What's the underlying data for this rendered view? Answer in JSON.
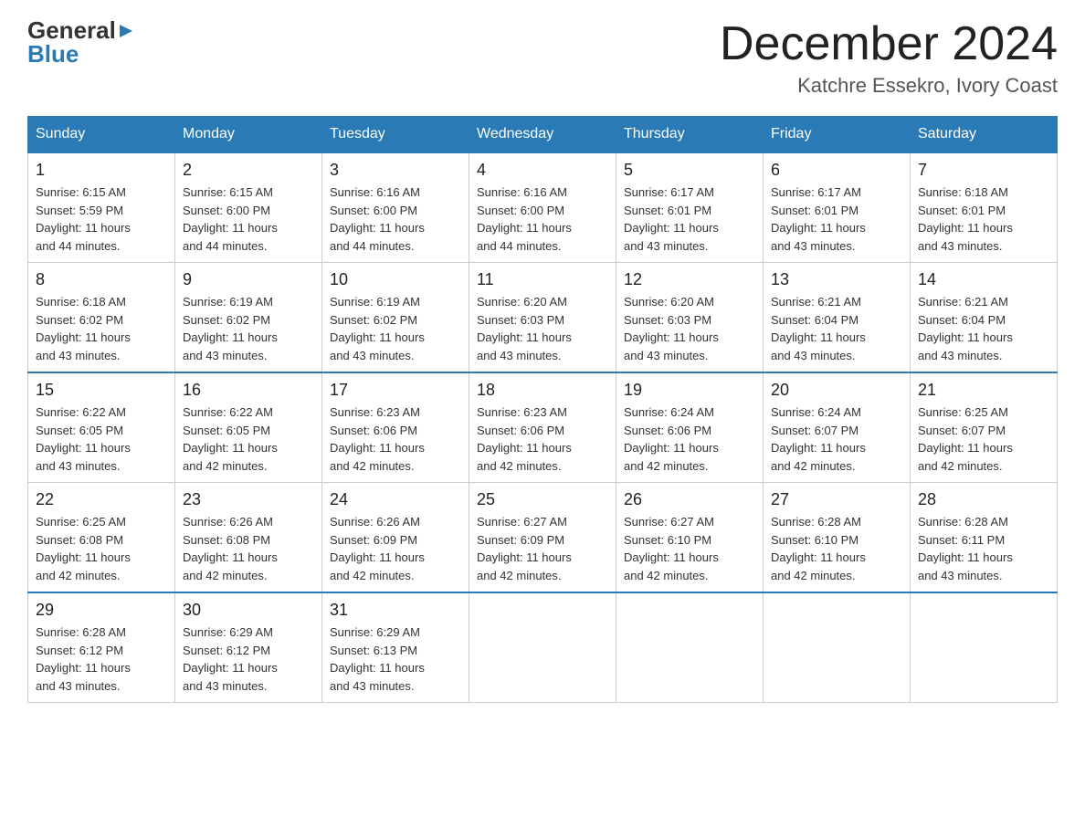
{
  "logo": {
    "general": "General",
    "blue": "Blue"
  },
  "title": "December 2024",
  "subtitle": "Katchre Essekro, Ivory Coast",
  "headers": [
    "Sunday",
    "Monday",
    "Tuesday",
    "Wednesday",
    "Thursday",
    "Friday",
    "Saturday"
  ],
  "weeks": [
    [
      {
        "day": "1",
        "info": "Sunrise: 6:15 AM\nSunset: 5:59 PM\nDaylight: 11 hours\nand 44 minutes."
      },
      {
        "day": "2",
        "info": "Sunrise: 6:15 AM\nSunset: 6:00 PM\nDaylight: 11 hours\nand 44 minutes."
      },
      {
        "day": "3",
        "info": "Sunrise: 6:16 AM\nSunset: 6:00 PM\nDaylight: 11 hours\nand 44 minutes."
      },
      {
        "day": "4",
        "info": "Sunrise: 6:16 AM\nSunset: 6:00 PM\nDaylight: 11 hours\nand 44 minutes."
      },
      {
        "day": "5",
        "info": "Sunrise: 6:17 AM\nSunset: 6:01 PM\nDaylight: 11 hours\nand 43 minutes."
      },
      {
        "day": "6",
        "info": "Sunrise: 6:17 AM\nSunset: 6:01 PM\nDaylight: 11 hours\nand 43 minutes."
      },
      {
        "day": "7",
        "info": "Sunrise: 6:18 AM\nSunset: 6:01 PM\nDaylight: 11 hours\nand 43 minutes."
      }
    ],
    [
      {
        "day": "8",
        "info": "Sunrise: 6:18 AM\nSunset: 6:02 PM\nDaylight: 11 hours\nand 43 minutes."
      },
      {
        "day": "9",
        "info": "Sunrise: 6:19 AM\nSunset: 6:02 PM\nDaylight: 11 hours\nand 43 minutes."
      },
      {
        "day": "10",
        "info": "Sunrise: 6:19 AM\nSunset: 6:02 PM\nDaylight: 11 hours\nand 43 minutes."
      },
      {
        "day": "11",
        "info": "Sunrise: 6:20 AM\nSunset: 6:03 PM\nDaylight: 11 hours\nand 43 minutes."
      },
      {
        "day": "12",
        "info": "Sunrise: 6:20 AM\nSunset: 6:03 PM\nDaylight: 11 hours\nand 43 minutes."
      },
      {
        "day": "13",
        "info": "Sunrise: 6:21 AM\nSunset: 6:04 PM\nDaylight: 11 hours\nand 43 minutes."
      },
      {
        "day": "14",
        "info": "Sunrise: 6:21 AM\nSunset: 6:04 PM\nDaylight: 11 hours\nand 43 minutes."
      }
    ],
    [
      {
        "day": "15",
        "info": "Sunrise: 6:22 AM\nSunset: 6:05 PM\nDaylight: 11 hours\nand 43 minutes."
      },
      {
        "day": "16",
        "info": "Sunrise: 6:22 AM\nSunset: 6:05 PM\nDaylight: 11 hours\nand 42 minutes."
      },
      {
        "day": "17",
        "info": "Sunrise: 6:23 AM\nSunset: 6:06 PM\nDaylight: 11 hours\nand 42 minutes."
      },
      {
        "day": "18",
        "info": "Sunrise: 6:23 AM\nSunset: 6:06 PM\nDaylight: 11 hours\nand 42 minutes."
      },
      {
        "day": "19",
        "info": "Sunrise: 6:24 AM\nSunset: 6:06 PM\nDaylight: 11 hours\nand 42 minutes."
      },
      {
        "day": "20",
        "info": "Sunrise: 6:24 AM\nSunset: 6:07 PM\nDaylight: 11 hours\nand 42 minutes."
      },
      {
        "day": "21",
        "info": "Sunrise: 6:25 AM\nSunset: 6:07 PM\nDaylight: 11 hours\nand 42 minutes."
      }
    ],
    [
      {
        "day": "22",
        "info": "Sunrise: 6:25 AM\nSunset: 6:08 PM\nDaylight: 11 hours\nand 42 minutes."
      },
      {
        "day": "23",
        "info": "Sunrise: 6:26 AM\nSunset: 6:08 PM\nDaylight: 11 hours\nand 42 minutes."
      },
      {
        "day": "24",
        "info": "Sunrise: 6:26 AM\nSunset: 6:09 PM\nDaylight: 11 hours\nand 42 minutes."
      },
      {
        "day": "25",
        "info": "Sunrise: 6:27 AM\nSunset: 6:09 PM\nDaylight: 11 hours\nand 42 minutes."
      },
      {
        "day": "26",
        "info": "Sunrise: 6:27 AM\nSunset: 6:10 PM\nDaylight: 11 hours\nand 42 minutes."
      },
      {
        "day": "27",
        "info": "Sunrise: 6:28 AM\nSunset: 6:10 PM\nDaylight: 11 hours\nand 42 minutes."
      },
      {
        "day": "28",
        "info": "Sunrise: 6:28 AM\nSunset: 6:11 PM\nDaylight: 11 hours\nand 43 minutes."
      }
    ],
    [
      {
        "day": "29",
        "info": "Sunrise: 6:28 AM\nSunset: 6:12 PM\nDaylight: 11 hours\nand 43 minutes."
      },
      {
        "day": "30",
        "info": "Sunrise: 6:29 AM\nSunset: 6:12 PM\nDaylight: 11 hours\nand 43 minutes."
      },
      {
        "day": "31",
        "info": "Sunrise: 6:29 AM\nSunset: 6:13 PM\nDaylight: 11 hours\nand 43 minutes."
      },
      null,
      null,
      null,
      null
    ]
  ]
}
